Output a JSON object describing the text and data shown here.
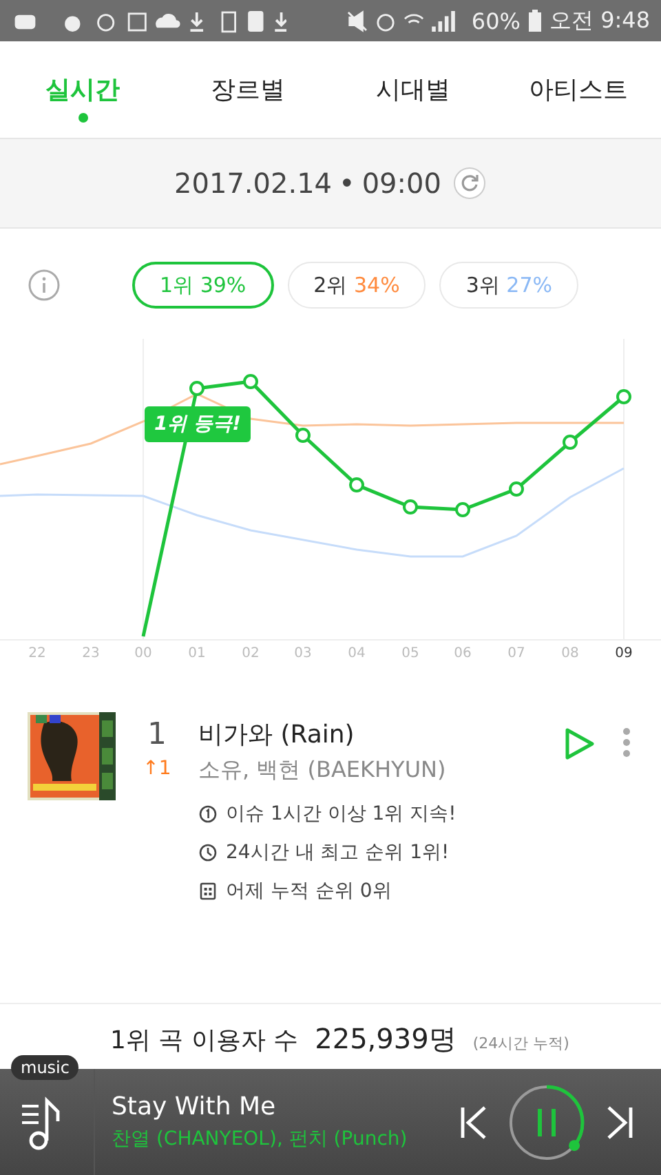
{
  "status_bar": {
    "battery": "60%",
    "time": "오전 9:48"
  },
  "tabs": [
    {
      "label": "실시간",
      "selected": true
    },
    {
      "label": "장르별",
      "selected": false
    },
    {
      "label": "시대별",
      "selected": false
    },
    {
      "label": "아티스트",
      "selected": false
    }
  ],
  "date_bar": {
    "date": "2017.02.14",
    "separator": "•",
    "time": "09:00"
  },
  "rank_chips": [
    {
      "rank": "1위",
      "share": "39%",
      "color": "#1ec43c",
      "selected": true
    },
    {
      "rank": "2위",
      "share": "34%",
      "color": "#ff8a3d",
      "selected": false
    },
    {
      "rank": "3위",
      "share": "27%",
      "color": "#8ab8f5",
      "selected": false
    }
  ],
  "chart": {
    "tag": "1위 등극!",
    "x_labels": [
      {
        "label": "22",
        "selected": false
      },
      {
        "label": "23",
        "selected": false
      },
      {
        "label": "00",
        "selected": false
      },
      {
        "label": "01",
        "selected": false
      },
      {
        "label": "02",
        "selected": false
      },
      {
        "label": "03",
        "selected": false
      },
      {
        "label": "04",
        "selected": false
      },
      {
        "label": "05",
        "selected": false
      },
      {
        "label": "06",
        "selected": false
      },
      {
        "label": "07",
        "selected": false
      },
      {
        "label": "08",
        "selected": false
      },
      {
        "label": "09",
        "selected": true
      }
    ]
  },
  "song": {
    "rank": "1",
    "change": "↑1",
    "title": "비가와 (Rain)",
    "artist": "소유, 백현 (BAEKHYUN)",
    "facts": [
      {
        "kind": "streak",
        "text": "이슈 1시간 이상 1위 지속!"
      },
      {
        "kind": "clock",
        "text": "24시간 내 최고 순위 1위!"
      },
      {
        "kind": "calendar",
        "text": "어제 누적 순위 0위"
      }
    ]
  },
  "stats": {
    "label": "1위 곡 이용자 수",
    "value": "225,939명",
    "note": "(24시간 누적)"
  },
  "player": {
    "badge": "music",
    "title": "Stay With Me",
    "artist": "찬열 (CHANYEOL), 펀치 (Punch)",
    "level": 0.36
  }
}
